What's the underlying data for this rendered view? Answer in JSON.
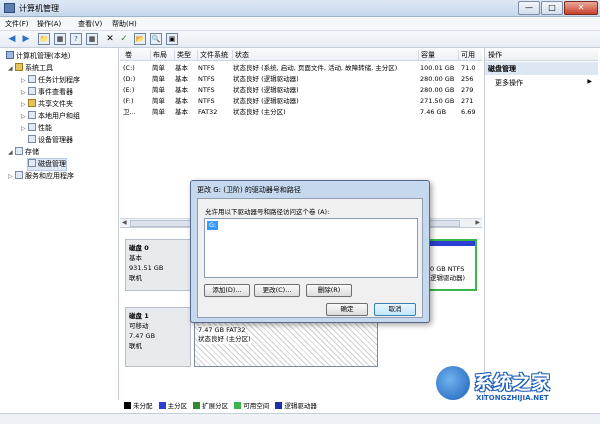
{
  "window": {
    "title": "计算机管理",
    "min": "—",
    "max": "□",
    "close": "✕"
  },
  "menu": [
    "文件(F)",
    "操作(A)",
    "查看(V)",
    "帮助(H)"
  ],
  "toolbar": [
    "◀",
    "▶",
    "📁",
    "▦",
    "?",
    "▦",
    "✕",
    "✓",
    "📂",
    "🔍",
    "▣"
  ],
  "nav": {
    "root": "计算机管理(本地)",
    "system_tools": "系统工具",
    "task_scheduler": "任务计划程序",
    "event_viewer": "事件查看器",
    "shared_folders": "共享文件夹",
    "local_users": "本地用户和组",
    "performance": "性能",
    "device_manager": "设备管理器",
    "storage": "存储",
    "disk_management": "磁盘管理",
    "services": "服务和应用程序"
  },
  "volumes": {
    "headers": [
      "卷",
      "布局",
      "类型",
      "文件系统",
      "状态",
      "容量",
      "可用"
    ],
    "rows": [
      [
        "(C:)",
        "简单",
        "基本",
        "NTFS",
        "状态良好 (系统, 启动, 页面文件, 活动, 故障转储, 主分区)",
        "100.01 GB",
        "71.0"
      ],
      [
        "(D:)",
        "简单",
        "基本",
        "NTFS",
        "状态良好 (逻辑驱动器)",
        "280.00 GB",
        "256"
      ],
      [
        "(E:)",
        "简单",
        "基本",
        "NTFS",
        "状态良好 (逻辑驱动器)",
        "280.00 GB",
        "279"
      ],
      [
        "(F:)",
        "简单",
        "基本",
        "NTFS",
        "状态良好 (逻辑驱动器)",
        "271.50 GB",
        "271"
      ],
      [
        "卫...",
        "简单",
        "基本",
        "FAT32",
        "状态良好 (主分区)",
        "7.46 GB",
        "6.69"
      ]
    ]
  },
  "disks": [
    {
      "name": "磁盘 0",
      "type": "基本",
      "size": "931.51 GB",
      "status": "联机"
    },
    {
      "name": "磁盘 1",
      "type": "可移动",
      "size": "7.47 GB",
      "status": "联机"
    }
  ],
  "partitions": {
    "d0_right": "0 GB NTFS",
    "d0_right_status": "逻辑驱动器)",
    "d1_size": "7.47 GB FAT32",
    "d1_status": "状态良好 (主分区)"
  },
  "legend": [
    {
      "label": "未分配",
      "color": "#000000"
    },
    {
      "label": "主分区",
      "color": "#2c3fd4"
    },
    {
      "label": "扩展分区",
      "color": "#2e8b2e"
    },
    {
      "label": "可用空间",
      "color": "#39b54a"
    },
    {
      "label": "逻辑驱动器",
      "color": "#1f2fa8"
    }
  ],
  "actions": {
    "header": "操作",
    "section": "磁盘管理",
    "more": "更多操作",
    "more_arrow": "▶"
  },
  "dialog": {
    "title": "更改 G: (卫阶) 的驱动器号和路径",
    "description": "允许用以下驱动器号和路径访问这个卷 (A):",
    "list_item": "G:",
    "add": "添加(D)...",
    "change": "更改(C)...",
    "remove": "删除(R)",
    "ok": "确定",
    "cancel": "取消"
  },
  "watermark": {
    "title": "系统之家",
    "url": "XITONGZHIJIA.NET"
  }
}
